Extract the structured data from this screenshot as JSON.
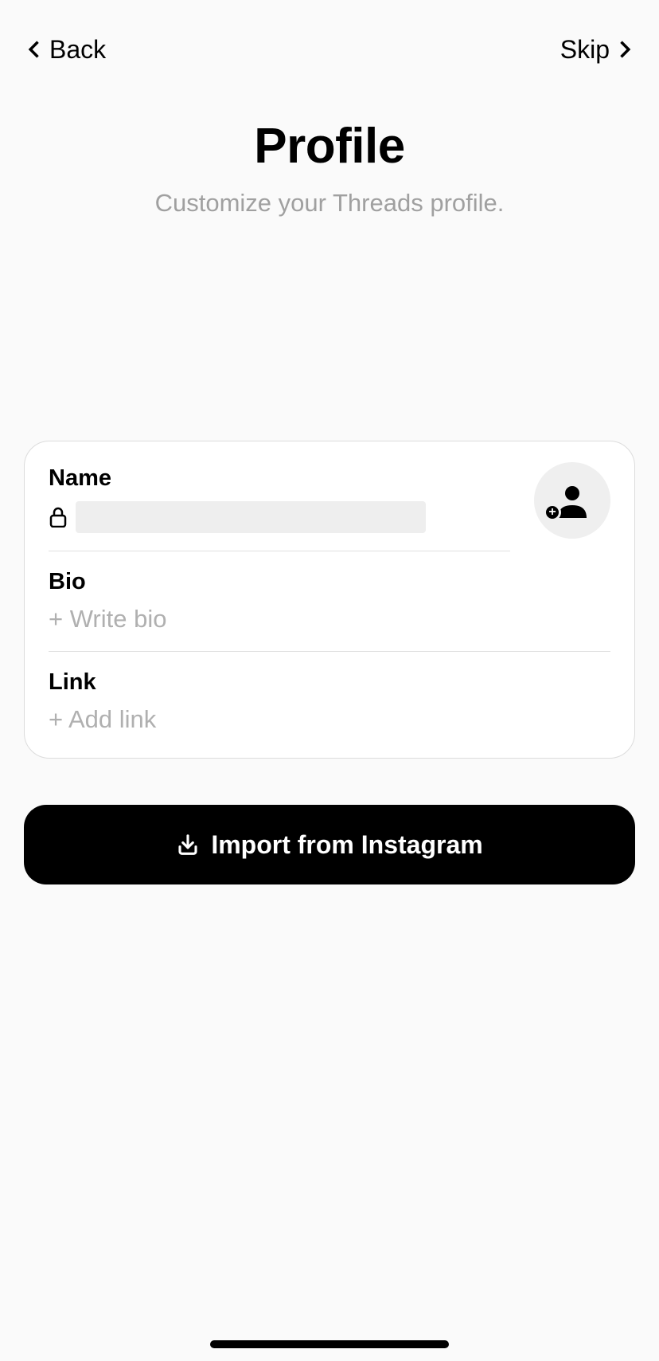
{
  "header": {
    "back_label": "Back",
    "skip_label": "Skip"
  },
  "title": "Profile",
  "subtitle": "Customize your Threads profile.",
  "fields": {
    "name_label": "Name",
    "bio_label": "Bio",
    "bio_placeholder": "+ Write bio",
    "link_label": "Link",
    "link_placeholder": "+ Add link"
  },
  "import_button": "Import from Instagram"
}
